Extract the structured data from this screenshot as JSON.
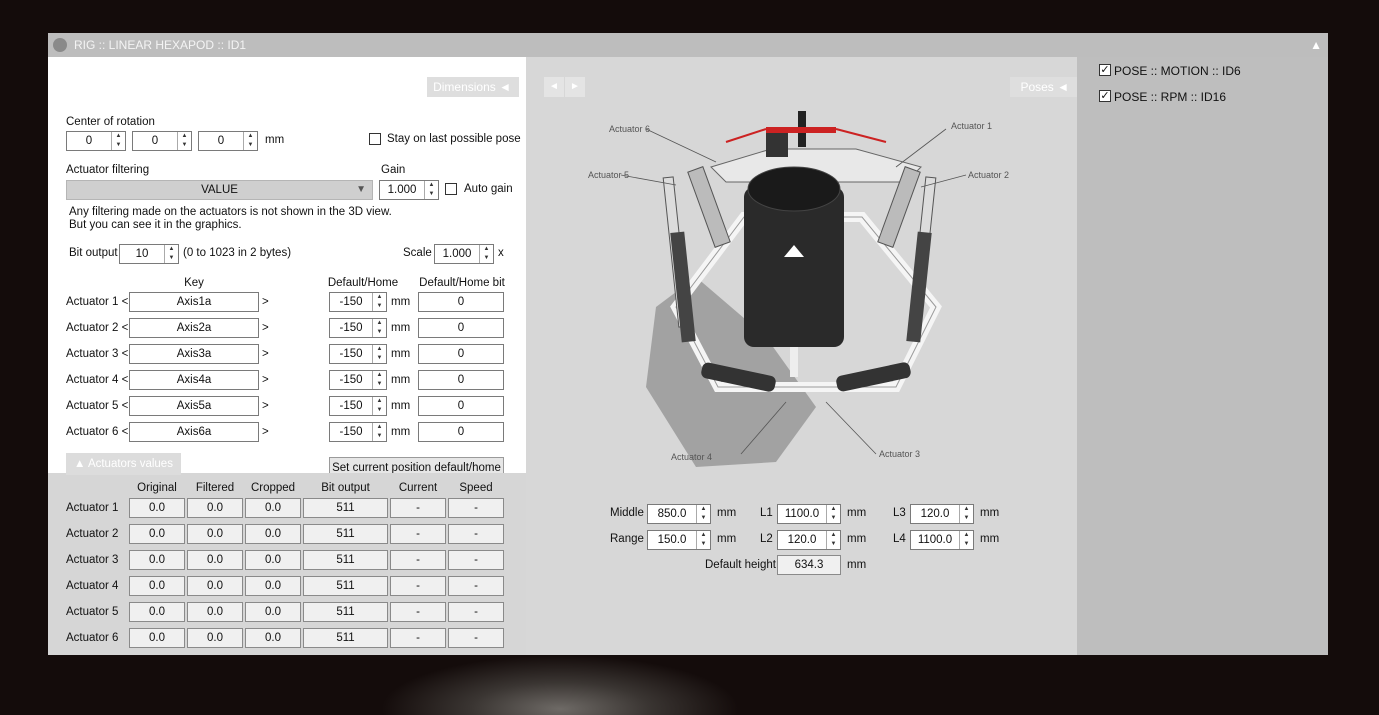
{
  "window": {
    "title": "RIG :: LINEAR HEXAPOD :: ID1",
    "collapse_glyph": "▲"
  },
  "left": {
    "dimensions_tab": "Dimensions ◄",
    "center_of_rotation": {
      "label": "Center of rotation",
      "x": "0",
      "y": "0",
      "z": "0",
      "unit": "mm"
    },
    "stay_on_last": {
      "label": "Stay on last possible pose",
      "checked": false
    },
    "actuator_filtering": {
      "label": "Actuator filtering",
      "value": "VALUE"
    },
    "gain": {
      "label": "Gain",
      "value": "1.000",
      "auto_label": "Auto gain",
      "auto_checked": false
    },
    "filter_note_1": "Any filtering made on the actuators is not shown in the 3D view.",
    "filter_note_2": "But you can see it in the graphics.",
    "bit_output": {
      "label": "Bit output",
      "value": "10",
      "note": "(0 to 1023 in 2 bytes)"
    },
    "scale": {
      "label": "Scale",
      "value": "1.000",
      "unit": "x"
    },
    "table_headers": {
      "key": "Key",
      "default_home": "Default/Home",
      "default_home_bit": "Default/Home bit"
    },
    "actuators": [
      {
        "label": "Actuator 1 <",
        "key": "Axis1a",
        "default": "-150",
        "bit": "0"
      },
      {
        "label": "Actuator 2 <",
        "key": "Axis2a",
        "default": "-150",
        "bit": "0"
      },
      {
        "label": "Actuator 3 <",
        "key": "Axis3a",
        "default": "-150",
        "bit": "0"
      },
      {
        "label": "Actuator 4 <",
        "key": "Axis4a",
        "default": "-150",
        "bit": "0"
      },
      {
        "label": "Actuator 5 <",
        "key": "Axis5a",
        "default": "-150",
        "bit": "0"
      },
      {
        "label": "Actuator 6 <",
        "key": "Axis6a",
        "default": "-150",
        "bit": "0"
      }
    ],
    "gt": ">",
    "unit_mm": "mm",
    "set_default_button": "Set current position default/home",
    "actuator_values_tab": "▲  Actuators values",
    "values_headers": {
      "original": "Original",
      "filtered": "Filtered",
      "cropped": "Cropped",
      "bit_output": "Bit output",
      "current": "Current",
      "speed": "Speed"
    },
    "values_rows": [
      {
        "label": "Actuator 1",
        "original": "0.0",
        "filtered": "0.0",
        "cropped": "0.0",
        "bit_output": "511",
        "current": "-",
        "speed": "-"
      },
      {
        "label": "Actuator 2",
        "original": "0.0",
        "filtered": "0.0",
        "cropped": "0.0",
        "bit_output": "511",
        "current": "-",
        "speed": "-"
      },
      {
        "label": "Actuator 3",
        "original": "0.0",
        "filtered": "0.0",
        "cropped": "0.0",
        "bit_output": "511",
        "current": "-",
        "speed": "-"
      },
      {
        "label": "Actuator 4",
        "original": "0.0",
        "filtered": "0.0",
        "cropped": "0.0",
        "bit_output": "511",
        "current": "-",
        "speed": "-"
      },
      {
        "label": "Actuator 5",
        "original": "0.0",
        "filtered": "0.0",
        "cropped": "0.0",
        "bit_output": "511",
        "current": "-",
        "speed": "-"
      },
      {
        "label": "Actuator 6",
        "original": "0.0",
        "filtered": "0.0",
        "cropped": "0.0",
        "bit_output": "511",
        "current": "-",
        "speed": "-"
      }
    ]
  },
  "middle": {
    "nav_prev": "◄",
    "nav_next": "►",
    "poses_tab": "Poses ◄",
    "actuator_labels": [
      "Actuator 1",
      "Actuator 2",
      "Actuator 3",
      "Actuator 4",
      "Actuator 5",
      "Actuator 6"
    ],
    "middle": {
      "label": "Middle",
      "value": "850.0",
      "unit": "mm"
    },
    "range": {
      "label": "Range",
      "value": "150.0",
      "unit": "mm"
    },
    "l1": {
      "label": "L1",
      "value": "1100.0",
      "unit": "mm"
    },
    "l2": {
      "label": "L2",
      "value": "120.0",
      "unit": "mm"
    },
    "l3": {
      "label": "L3",
      "value": "120.0",
      "unit": "mm"
    },
    "l4": {
      "label": "L4",
      "value": "1100.0",
      "unit": "mm"
    },
    "default_height": {
      "label": "Default height",
      "value": "634.3",
      "unit": "mm"
    }
  },
  "right": {
    "poses": [
      {
        "label": "POSE :: MOTION :: ID6",
        "checked": true
      },
      {
        "label": "POSE :: RPM :: ID16",
        "checked": true
      }
    ]
  },
  "colors": {
    "window_bg": "#cfcfcf",
    "titlebar": "#bdbdbd",
    "accent_red": "#cc2222"
  }
}
